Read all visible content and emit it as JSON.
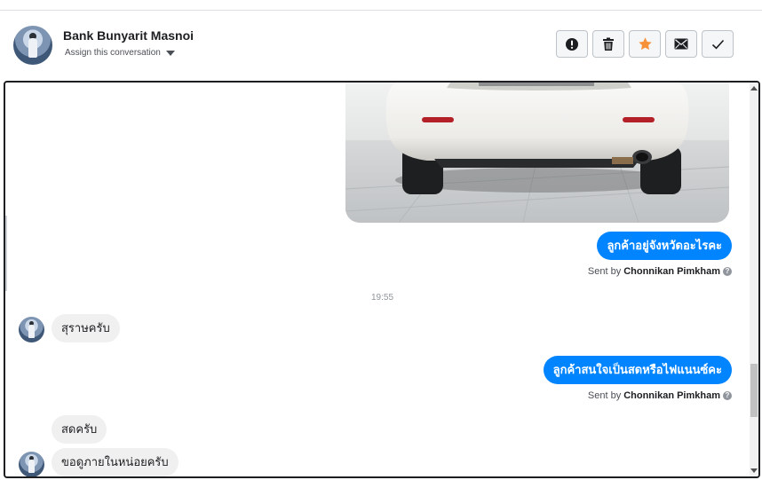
{
  "header": {
    "contact_name": "Bank Bunyarit Masnoi",
    "assign_label": "Assign this conversation",
    "actions": [
      {
        "name": "spam",
        "icon": "exclamation-circle-icon"
      },
      {
        "name": "delete",
        "icon": "trash-icon"
      },
      {
        "name": "star",
        "icon": "star-icon",
        "color": "#f7923b"
      },
      {
        "name": "mark-unread",
        "icon": "envelope-icon"
      },
      {
        "name": "done",
        "icon": "checkmark-icon"
      }
    ]
  },
  "colors": {
    "outgoing_bubble": "#0084ff",
    "incoming_bubble": "#f1f0f0",
    "star": "#f7923b"
  },
  "messages": {
    "photo": {
      "description_icon": "car-photo"
    },
    "out_1": {
      "text": "ลูกค้าอยู่จังหวัดอะไรคะ",
      "sent_by_prefix": "Sent by",
      "sent_by_name": "Chonnikan Pimkham"
    },
    "timestamp": "19:55",
    "in_1": {
      "text": "สุราษครับ"
    },
    "out_2": {
      "text": "ลูกค้าสนใจเป็นสดหรือไฟแนนซ์คะ",
      "sent_by_prefix": "Sent by",
      "sent_by_name": "Chonnikan Pimkham"
    },
    "in_2": {
      "text": "สดครับ"
    },
    "in_3": {
      "text": "ขอดูภายในหน่อยครับ"
    }
  }
}
